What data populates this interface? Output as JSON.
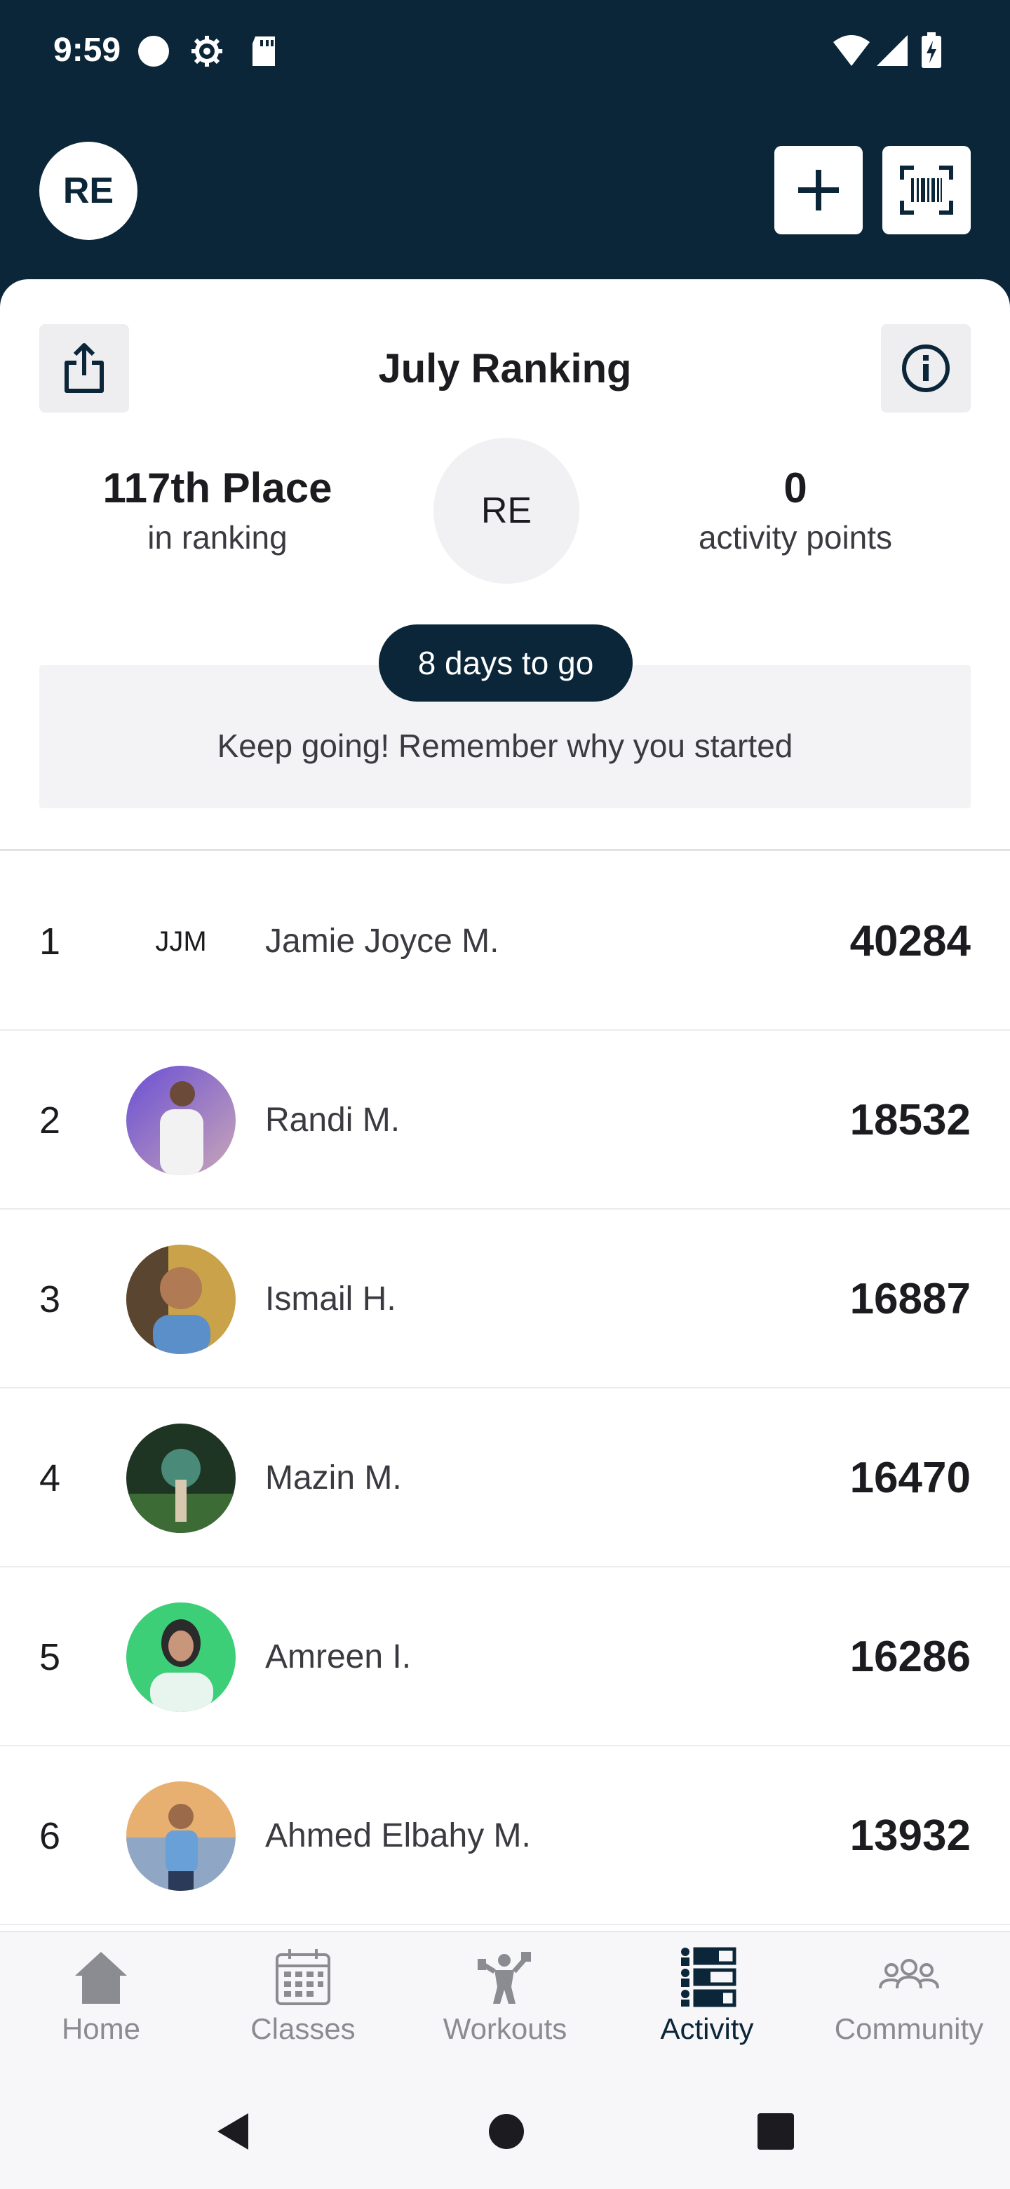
{
  "status_bar": {
    "time": "9:59"
  },
  "header": {
    "user_initials": "RE"
  },
  "ranking": {
    "title": "July Ranking",
    "place_value": "117th Place",
    "place_label": "in ranking",
    "user_initials": "RE",
    "points_value": "0",
    "points_label": "activity points",
    "days_to_go": "8 days to go",
    "motivation": "Keep going! Remember why you started"
  },
  "leaderboard": [
    {
      "rank": "1",
      "initials": "JJM",
      "name": "Jamie Joyce M.",
      "score": "40284"
    },
    {
      "rank": "2",
      "name": "Randi M.",
      "score": "18532"
    },
    {
      "rank": "3",
      "name": "Ismail H.",
      "score": "16887"
    },
    {
      "rank": "4",
      "name": "Mazin M.",
      "score": "16470"
    },
    {
      "rank": "5",
      "name": "Amreen I.",
      "score": "16286"
    },
    {
      "rank": "6",
      "name": "Ahmed Elbahy M.",
      "score": "13932"
    }
  ],
  "bottom_nav": {
    "items": [
      {
        "label": "Home",
        "icon": "home-icon"
      },
      {
        "label": "Classes",
        "icon": "calendar-icon"
      },
      {
        "label": "Workouts",
        "icon": "dumbbell-icon"
      },
      {
        "label": "Activity",
        "icon": "leaderboard-icon",
        "active": true
      },
      {
        "label": "Community",
        "icon": "people-icon"
      }
    ]
  },
  "colors": {
    "primary": "#0b2638",
    "background": "#ffffff",
    "muted_surface": "#f3f3f5",
    "inactive_nav": "#8b8b92"
  }
}
